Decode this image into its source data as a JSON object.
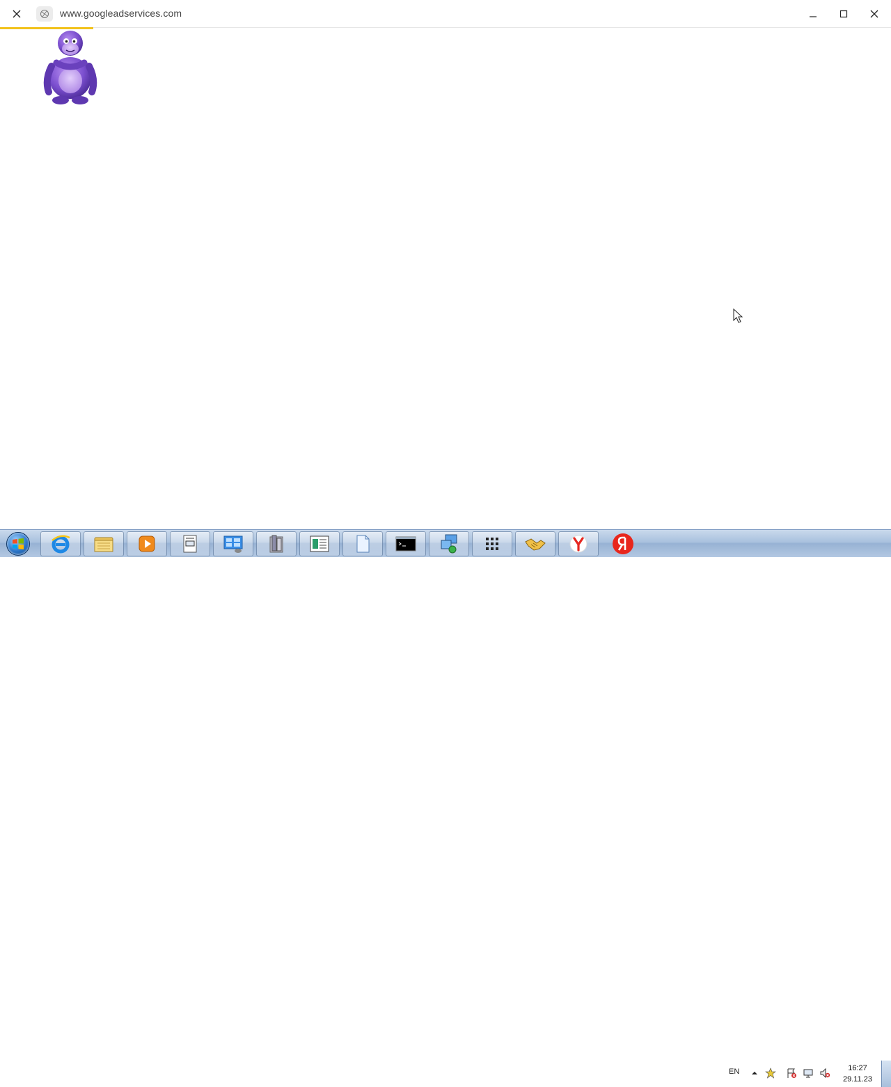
{
  "browser": {
    "url": "www.googleadservices.com",
    "load_progress": 0.105
  },
  "window_controls": {
    "minimize_icon": "minimize-icon",
    "maximize_icon": "maximize-icon",
    "close_icon": "close-icon"
  },
  "taskbar": {
    "start_icon": "windows-start-icon",
    "pinned": [
      {
        "name": "internet-explorer"
      },
      {
        "name": "file-explorer"
      },
      {
        "name": "media-player"
      },
      {
        "name": "notepad-document"
      },
      {
        "name": "control-panel"
      },
      {
        "name": "archive-tool"
      },
      {
        "name": "text-editor"
      },
      {
        "name": "blank-document"
      },
      {
        "name": "command-prompt"
      },
      {
        "name": "network-setup"
      },
      {
        "name": "app-grid"
      },
      {
        "name": "handshake-app"
      },
      {
        "name": "yandex-browser"
      },
      {
        "name": "yandex"
      }
    ],
    "tray": {
      "language": "EN",
      "time": "16:27",
      "date": "29.11.23"
    }
  },
  "colors": {
    "load_bar": "#f2c21b",
    "taskbar": "#a9c1de",
    "mascot": "#7b4fcf"
  }
}
